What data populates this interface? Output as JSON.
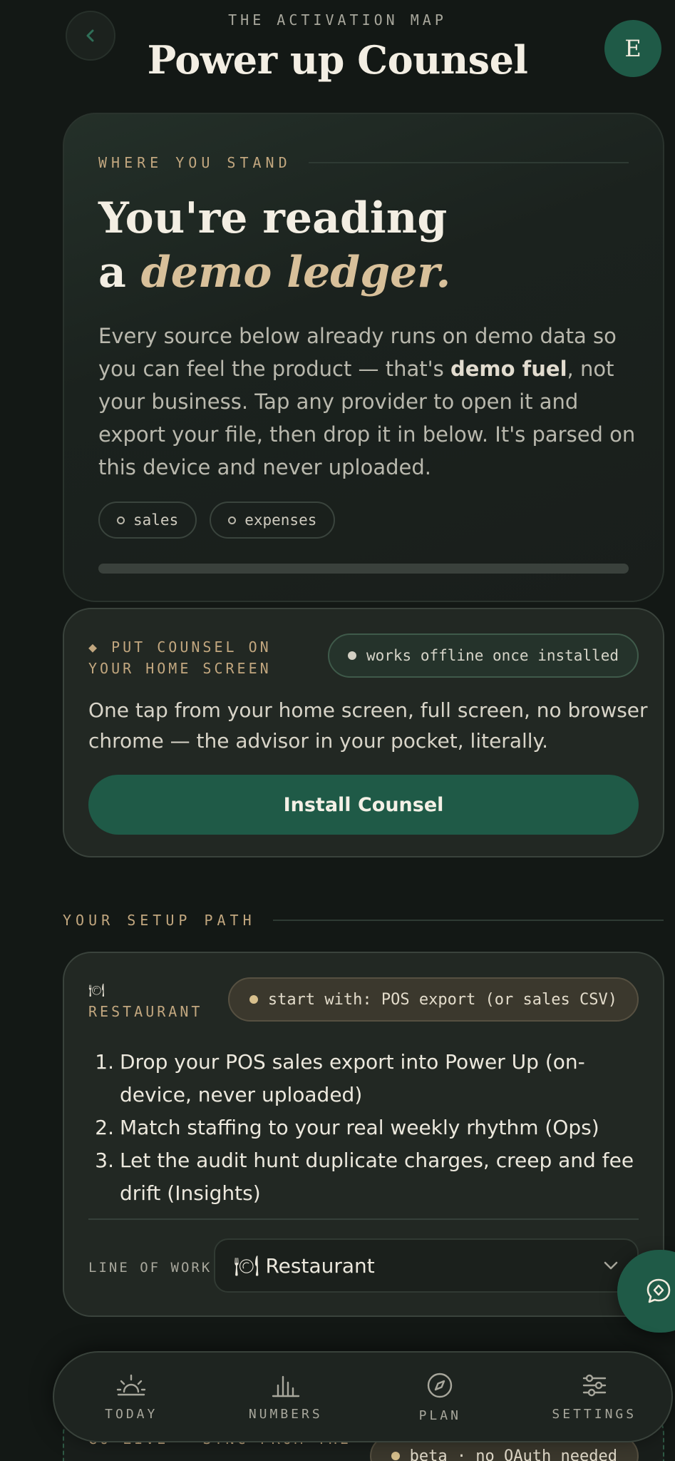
{
  "header": {
    "eyebrow": "THE ACTIVATION MAP",
    "title": "Power up Counsel",
    "avatar_initial": "E"
  },
  "hero": {
    "eyebrow": "WHERE YOU STAND",
    "title_line1": "You're reading",
    "title_prefix": "a ",
    "title_accent": "demo ledger.",
    "body_part1": "Every source below already runs on demo data so you can feel the product — that's ",
    "body_bold": "demo fuel",
    "body_part2": ", not your business. Tap any provider to open it and export your file, then drop it in below. It's parsed on this device and never uploaded.",
    "chips": [
      "sales",
      "expenses"
    ],
    "progress": 0
  },
  "install_card": {
    "eyebrow": "◆ PUT COUNSEL ON YOUR HOME SCREEN",
    "pill": "works offline once installed",
    "body": "One tap from your home screen, full screen, no browser chrome — the advisor in your pocket, literally.",
    "button": "Install Counsel"
  },
  "setup": {
    "eyebrow": "YOUR SETUP PATH",
    "persona_icon": "🍽",
    "persona_label": "RESTAURANT",
    "start_pill": "start with: POS export (or sales CSV)",
    "steps": [
      {
        "num": "1.",
        "text": "Drop your POS sales export into Power Up (on-device, never uploaded)"
      },
      {
        "num": "2.",
        "text": "Match staffing to your real weekly rhythm (Ops)"
      },
      {
        "num": "3.",
        "text": "Let the audit hunt duplicate charges, creep and fee drift (Insights)"
      }
    ],
    "line_of_work_label": "LINE OF WORK",
    "line_of_work_value": "🍽 Restaurant"
  },
  "peek": {
    "title": "GO LIVE — SYNC FROM THE",
    "pill": "beta · no OAuth needed"
  },
  "nav": {
    "items": [
      {
        "label": "TODAY",
        "icon": "sunrise-icon"
      },
      {
        "label": "NUMBERS",
        "icon": "bar-chart-icon"
      },
      {
        "label": "PLAN",
        "icon": "compass-icon"
      },
      {
        "label": "SETTINGS",
        "icon": "sliders-icon"
      }
    ]
  },
  "colors": {
    "background": "#131815",
    "accent_green": "#1f5a47",
    "accent_gold": "#c2a77f"
  }
}
